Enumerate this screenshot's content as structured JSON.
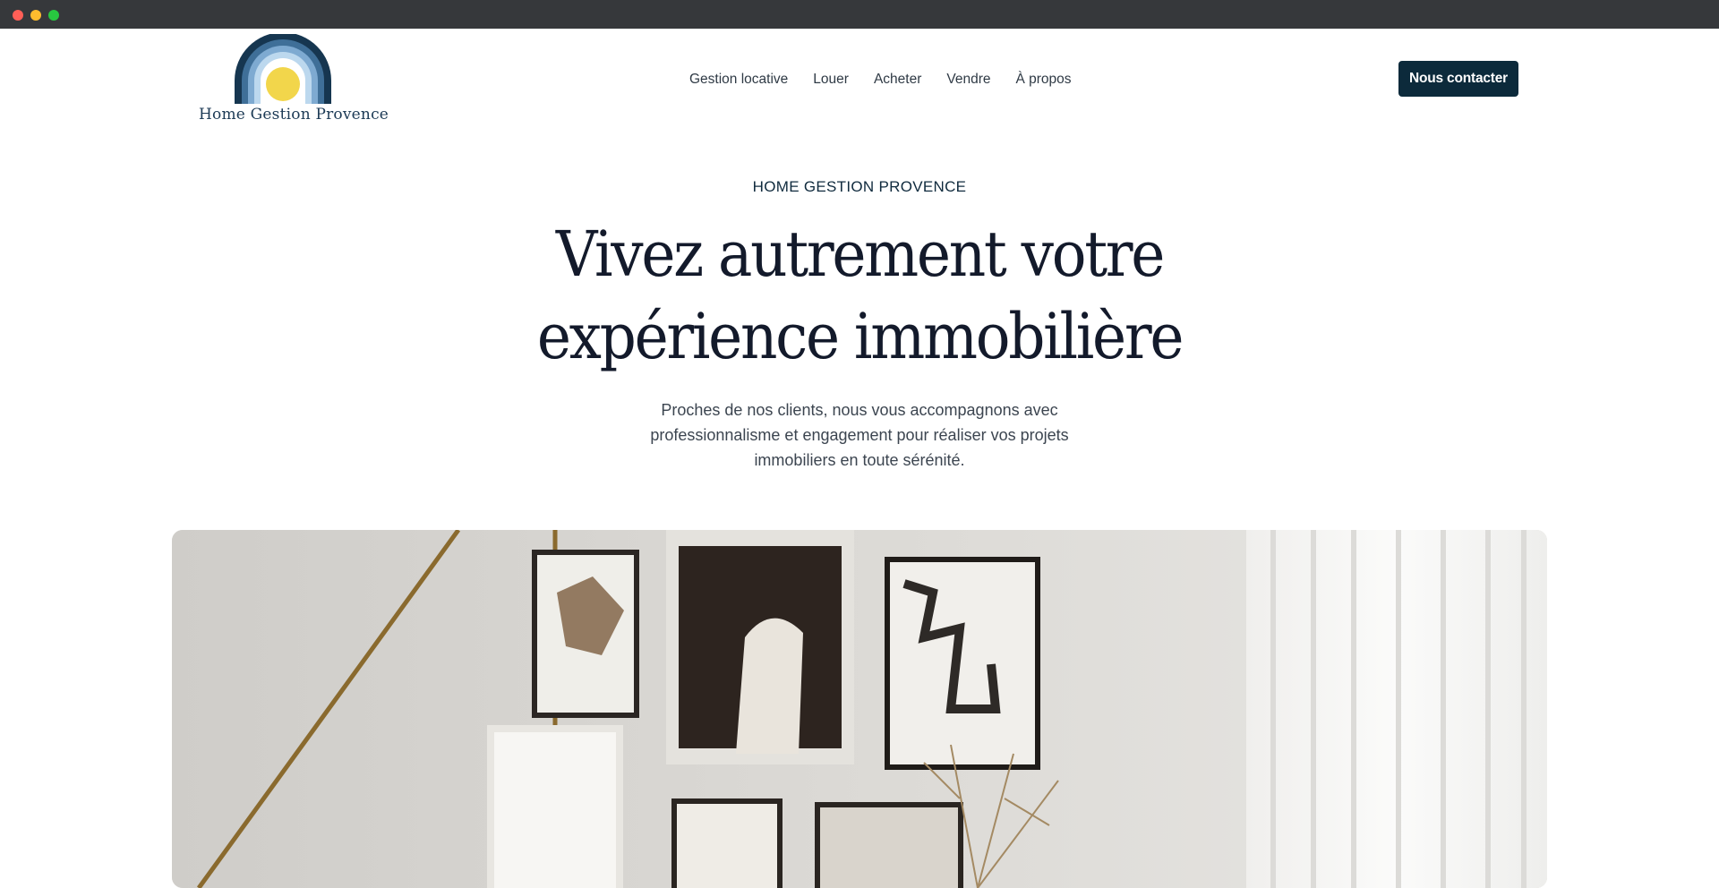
{
  "window": {
    "controls": [
      "close",
      "minimize",
      "maximize"
    ]
  },
  "header": {
    "logo_text": "Home Gestion Provence",
    "nav": [
      {
        "label": "Gestion locative"
      },
      {
        "label": "Louer"
      },
      {
        "label": "Acheter"
      },
      {
        "label": "Vendre"
      },
      {
        "label": "À propos"
      }
    ],
    "cta_label": "Nous contacter"
  },
  "hero": {
    "eyebrow": "HOME GESTION PROVENCE",
    "headline_line1": "Vivez autrement votre",
    "headline_line2": "expérience immobilière",
    "subtitle": "Proches de nos clients, nous vous accompagnons avec professionnalisme et engagement pour réaliser vos projets immobiliers en toute sérénité.",
    "image": "interior-gallery-wall-photo"
  },
  "colors": {
    "primary_dark": "#0c2a3b",
    "sun_yellow": "#f2d64b",
    "arch_blue": "#1c3a55"
  }
}
